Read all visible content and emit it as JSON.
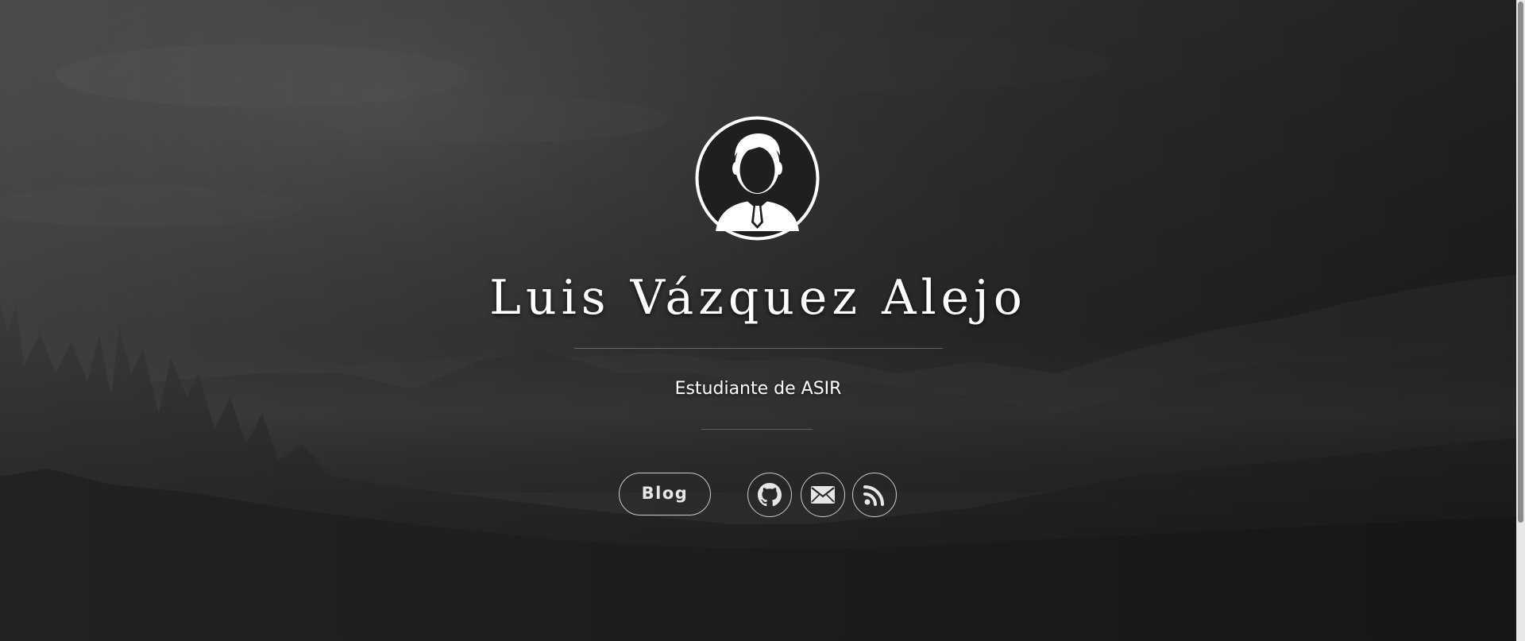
{
  "profile": {
    "name": "Luis Vázquez Alejo",
    "subtitle": "Estudiante de ASIR",
    "avatar_icon": "user-avatar-icon"
  },
  "actions": {
    "blog_label": "Blog",
    "links": [
      {
        "icon": "github-icon",
        "label": "GitHub"
      },
      {
        "icon": "mail-icon",
        "label": "Email"
      },
      {
        "icon": "rss-icon",
        "label": "RSS"
      }
    ]
  },
  "colors": {
    "text": "#ffffff",
    "button_border": "#d9d9d9",
    "background_dark": "#1c1c1c"
  }
}
